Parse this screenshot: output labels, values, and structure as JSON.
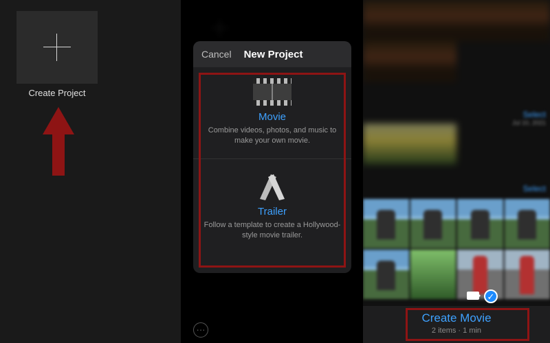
{
  "panel1": {
    "create_label": "Create Project"
  },
  "panel2": {
    "header": {
      "cancel": "Cancel",
      "title": "New Project"
    },
    "options": {
      "movie": {
        "title": "Movie",
        "subtitle": "Combine videos, photos, and music to make your own movie."
      },
      "trailer": {
        "title": "Trailer",
        "subtitle": "Follow a template to create a Hollywood-style movie trailer."
      }
    },
    "more": "···"
  },
  "panel3": {
    "select_label": "Select",
    "select_date": "Jul 10, 2021",
    "select_label2": "Select",
    "create_movie": {
      "title": "Create Movie",
      "subtitle": "2 items · 1 min"
    },
    "check_glyph": "✓"
  }
}
